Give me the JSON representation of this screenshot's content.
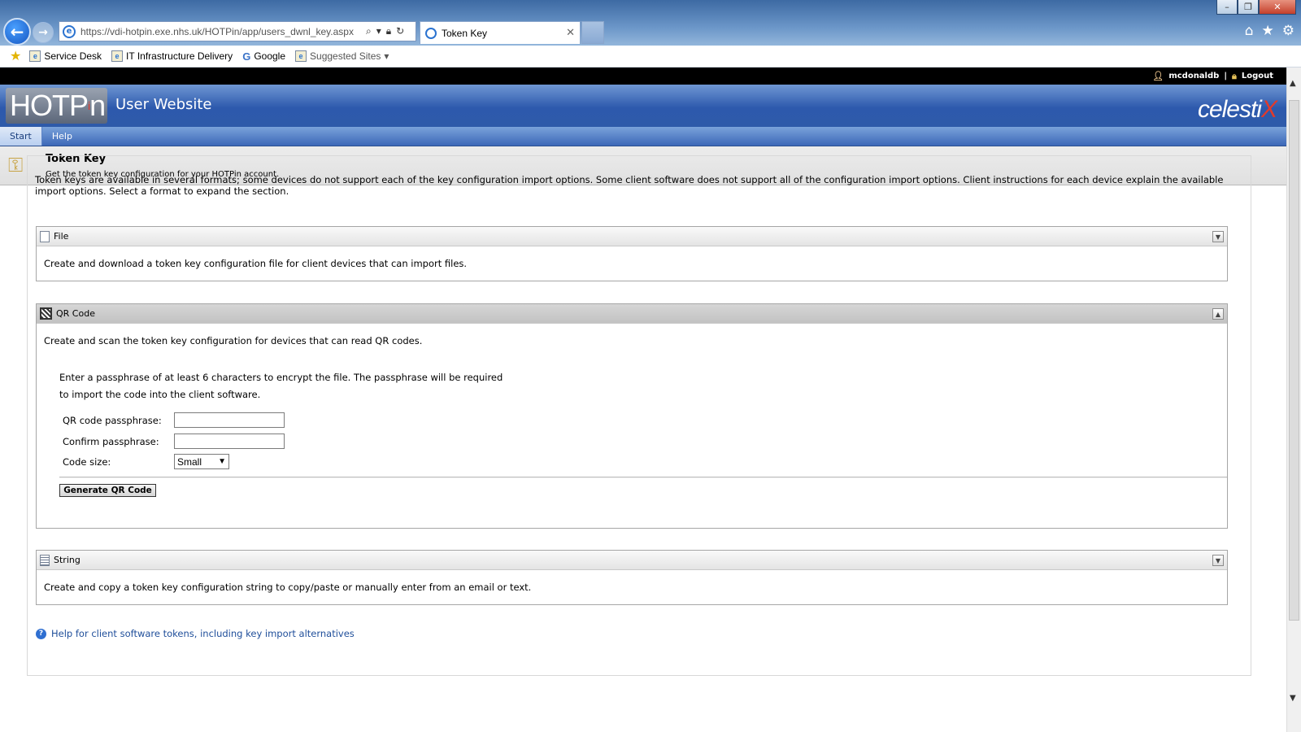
{
  "browser": {
    "url": "https://vdi-hotpin.exe.nhs.uk/HOTPin/app/users_dwnl_key.aspx",
    "tab_title": "Token Key",
    "favorites": [
      "Service Desk",
      "IT Infrastructure Delivery",
      "Google",
      "Suggested Sites"
    ]
  },
  "header": {
    "username": "mcdonaldb",
    "separator": "|",
    "logout": "Logout",
    "logo_text": "HOTP",
    "logo_accent": "i",
    "logo_suffix": "n",
    "site_title": "User Website",
    "brand": "celesti",
    "brand_x": "X",
    "accent_color": "#e33a2a"
  },
  "menu": {
    "items": [
      "Start",
      "Help"
    ]
  },
  "page": {
    "title": "Token Key",
    "description": "Get the token key configuration for your HOTPin account.",
    "intro": "Token keys are available in several formats; some devices do not support each of the key configuration import options. Some client software does not support all of the configuration import options. Client instructions for each device explain the available import options. Select a format to expand the section."
  },
  "panels": {
    "file": {
      "title": "File",
      "description": "Create and download a token key configuration file for client devices that can import files."
    },
    "qr": {
      "title": "QR Code",
      "description": "Create and scan the token key configuration for devices that can read QR codes.",
      "instructions": "Enter a passphrase of at least 6 characters to encrypt the file. The passphrase will be required to import the code into the client software.",
      "passphrase_label": "QR code passphrase:",
      "confirm_label": "Confirm passphrase:",
      "size_label": "Code size:",
      "size_value": "Small",
      "button": "Generate QR Code"
    },
    "string": {
      "title": "String",
      "description": "Create and copy a token key configuration string to copy/paste or manually enter from an email or text."
    }
  },
  "help_link": "Help for client software tokens, including key import alternatives"
}
